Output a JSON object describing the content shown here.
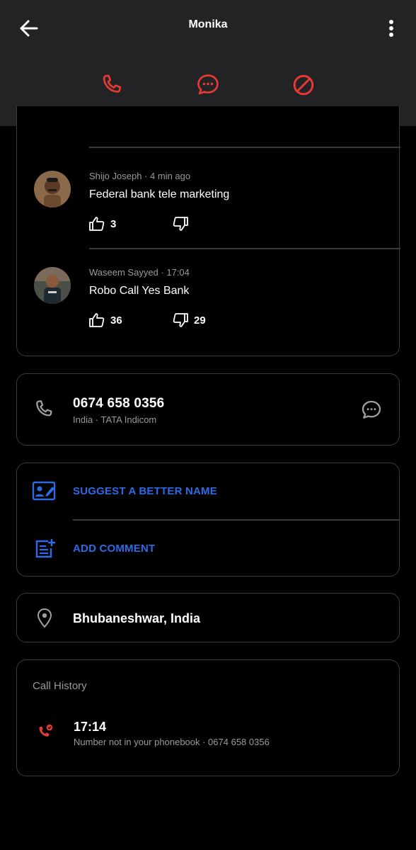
{
  "header": {
    "title": "Monika",
    "icons": [
      "back-arrow-icon",
      "more-vertical-icon",
      "phone-icon",
      "message-icon",
      "block-icon"
    ],
    "accent_color": "#e53935"
  },
  "comments": [
    {
      "author": "Shijo Joseph",
      "time": "4 min ago",
      "text": "Federal bank tele marketing",
      "likes": "3",
      "dislikes": ""
    },
    {
      "author": "Waseem Sayyed",
      "time": "17:04",
      "text": "Robo Call Yes Bank",
      "likes": "36",
      "dislikes": "29"
    }
  ],
  "number": {
    "value": "0674 658 0356",
    "carrier": "India · TATA Indicom"
  },
  "actions": {
    "suggest_name": "SUGGEST A BETTER NAME",
    "add_comment": "ADD COMMENT",
    "link_color": "#2d6ae6"
  },
  "location": {
    "text": "Bhubaneshwar, India"
  },
  "call_history": {
    "title": "Call History",
    "entries": [
      {
        "time": "17:14",
        "detail": "Number not in your phonebook · 0674 658 0356"
      }
    ]
  }
}
